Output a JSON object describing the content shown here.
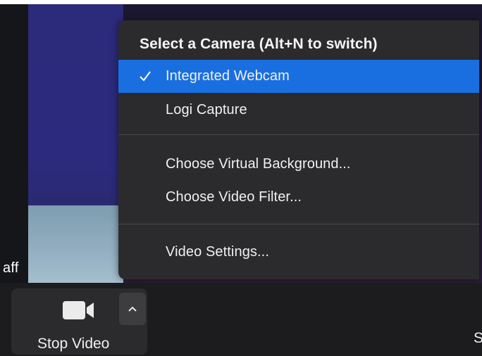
{
  "video": {
    "participant_name_partial": "aff"
  },
  "camera_menu": {
    "header": "Select a Camera (Alt+N to switch)",
    "items": [
      {
        "label": "Integrated Webcam",
        "selected": true
      },
      {
        "label": "Logi Capture",
        "selected": false
      },
      {
        "label": "Choose Virtual Background..."
      },
      {
        "label": "Choose Video Filter..."
      },
      {
        "label": "Video Settings..."
      }
    ],
    "selected_color": "#1a6fe0"
  },
  "toolbar": {
    "stop_video_label": "Stop Video",
    "partial_next_label": "S",
    "icons": [
      "video-camera-icon",
      "chevron-up-icon"
    ]
  }
}
